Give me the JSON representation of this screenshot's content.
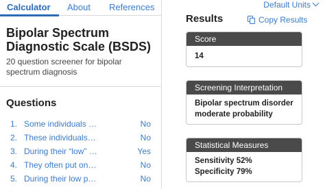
{
  "tabs": [
    {
      "label": "Calculator"
    },
    {
      "label": "About"
    },
    {
      "label": "References"
    }
  ],
  "calculator": {
    "title": "Bipolar Spectrum Diagnostic Scale (BSDS)",
    "description": "20 question screener for bipolar spectrum diagnosis"
  },
  "questions": {
    "heading": "Questions",
    "items": [
      {
        "num": "1.",
        "text": "Some individuals notice",
        "answer": "No"
      },
      {
        "num": "2.",
        "text": "These individuals notice",
        "answer": "No"
      },
      {
        "num": "3.",
        "text": "During their “low” periods",
        "answer": "Yes"
      },
      {
        "num": "4.",
        "text": "They often put on weight",
        "answer": "No"
      },
      {
        "num": "5.",
        "text": "During their low phases",
        "answer": "No"
      }
    ]
  },
  "header": {
    "default_units": "Default Units"
  },
  "results": {
    "title": "Results",
    "copy_label": "Copy Results",
    "cards": [
      {
        "heading": "Score",
        "value": "14"
      },
      {
        "heading": "Screening Interpretation",
        "value": "Bipolar spectrum disorder moderate probability"
      },
      {
        "heading": "Statistical Measures",
        "value": "Sensitivity 52% Specificity 79%"
      }
    ]
  },
  "colors": {
    "accent": "#2c6bb8",
    "link": "#3a7bc8",
    "card_header": "#4a4a4a"
  }
}
